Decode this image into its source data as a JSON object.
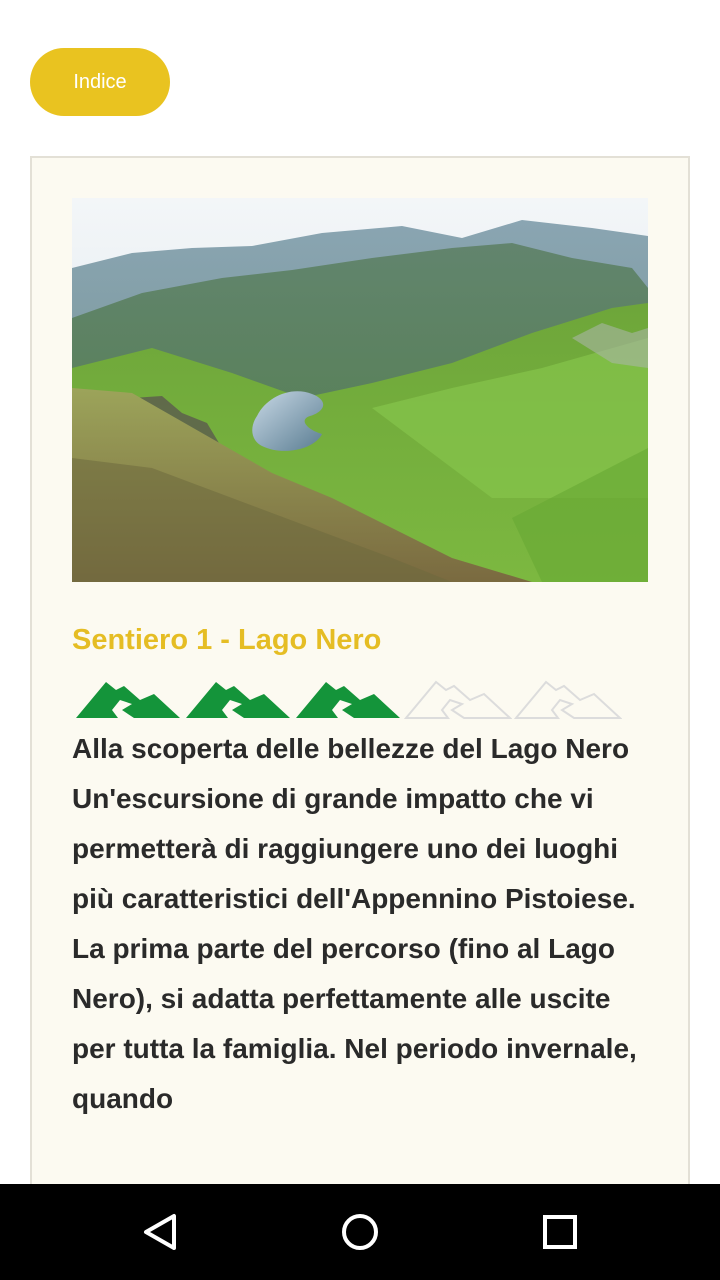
{
  "header": {
    "index_button_label": "Indice"
  },
  "trail": {
    "title": "Sentiero 1 - Lago Nero",
    "image_alt": "Vista del Lago Nero nell'Appennino Pistoiese",
    "difficulty": {
      "level": 3,
      "max": 5
    },
    "subtitle": "Alla scoperta delle bellezze del Lago Nero",
    "description": "Un'escursione di grande impatto che vi permetterà di raggiungere uno dei luoghi più caratteristici dell'Appennino Pistoiese. La prima parte del percorso (fino al Lago Nero), si adatta perfettamente alle uscite per tutta la famiglia. Nel periodo invernale, quando"
  },
  "colors": {
    "accent": "#e9c320",
    "title": "#e5bd24",
    "difficulty_on": "#14943a",
    "difficulty_off": "#dcdcdc"
  },
  "navigation": {
    "back_icon": "back-triangle-icon",
    "home_icon": "home-circle-icon",
    "recents_icon": "recents-square-icon"
  }
}
